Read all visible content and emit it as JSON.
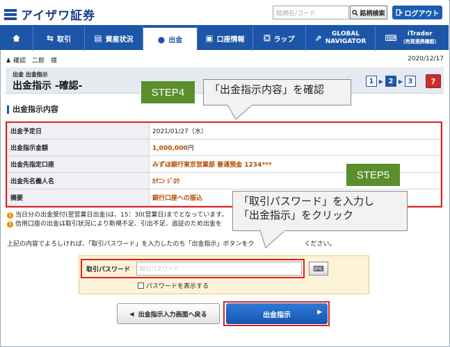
{
  "header": {
    "logo_text": "アイザワ証券",
    "search_placeholder": "銘柄名/コード",
    "search_button": "銘柄検索",
    "logout_button": "ログアウト"
  },
  "nav": {
    "items": [
      {
        "label": "",
        "icon": "home-icon"
      },
      {
        "label": "取引",
        "icon": "exchange-icon"
      },
      {
        "label": "資産状況",
        "icon": "briefcase-icon"
      },
      {
        "label": "出金",
        "icon": "money-bag-icon"
      },
      {
        "label": "口座情報",
        "icon": "id-card-icon"
      },
      {
        "label": "ラップ",
        "icon": "bag-icon"
      },
      {
        "label_line1": "GLOBAL",
        "label_line2": "NAVIGATOR",
        "icon": "external-link-icon"
      },
      {
        "label_line1": "iTrader",
        "label_line2": "（売買連携機能）",
        "icon": "monitor-icon"
      }
    ],
    "active": "出金"
  },
  "user": {
    "name": "確認　二郎　様",
    "date": "2020/12/17"
  },
  "page": {
    "breadcrumb": "出金 出金指示",
    "title": "出金指示 -確認-",
    "steps": [
      "1",
      "2",
      "3"
    ],
    "current_step": "2",
    "help": "?"
  },
  "section": {
    "title": "出金指示内容"
  },
  "details": [
    {
      "label": "出金予定日",
      "value": "2021/01/27（水）"
    },
    {
      "label": "出金指示金額",
      "value": "1,000,000",
      "unit": "円"
    },
    {
      "label": "出金先指定口座",
      "value": "みずほ銀行東京営業部 普通預金 1234***"
    },
    {
      "label": "出金先名義人名",
      "value": "ｶｸﾆﾝ ｼﾞﾛｳ"
    },
    {
      "label": "摘要",
      "value": "銀行口座への振込"
    }
  ],
  "notes": [
    "当日分の出金受付(翌営業日出金)は、15：30(営業日)までとなっています。",
    "信用口座の出金は取引状況により新規不足、引出不足、追証のため出金を"
  ],
  "instruction": "上記の内容でよろしければ、「取引パスワード」を入力したのち「出金指示」ボタンをク　　　　　　　　ください。",
  "password": {
    "label": "取引パスワード",
    "placeholder": "取引パスワード",
    "show_label": "パスワードを表示する"
  },
  "buttons": {
    "back": "出金指示入力画面へ戻る",
    "submit": "出金指示"
  },
  "annotations": {
    "step4": "STEP4",
    "step5": "STEP5",
    "callout1": "「出金指示内容」を確認",
    "callout2_line1": "「取引パスワード」を入力し",
    "callout2_line2": "「出金指示」をクリック"
  },
  "colors": {
    "brand_blue": "#1d56a8",
    "highlight_red": "#e02020",
    "step_green": "#5a8f2c",
    "value_orange": "#b34a00"
  }
}
